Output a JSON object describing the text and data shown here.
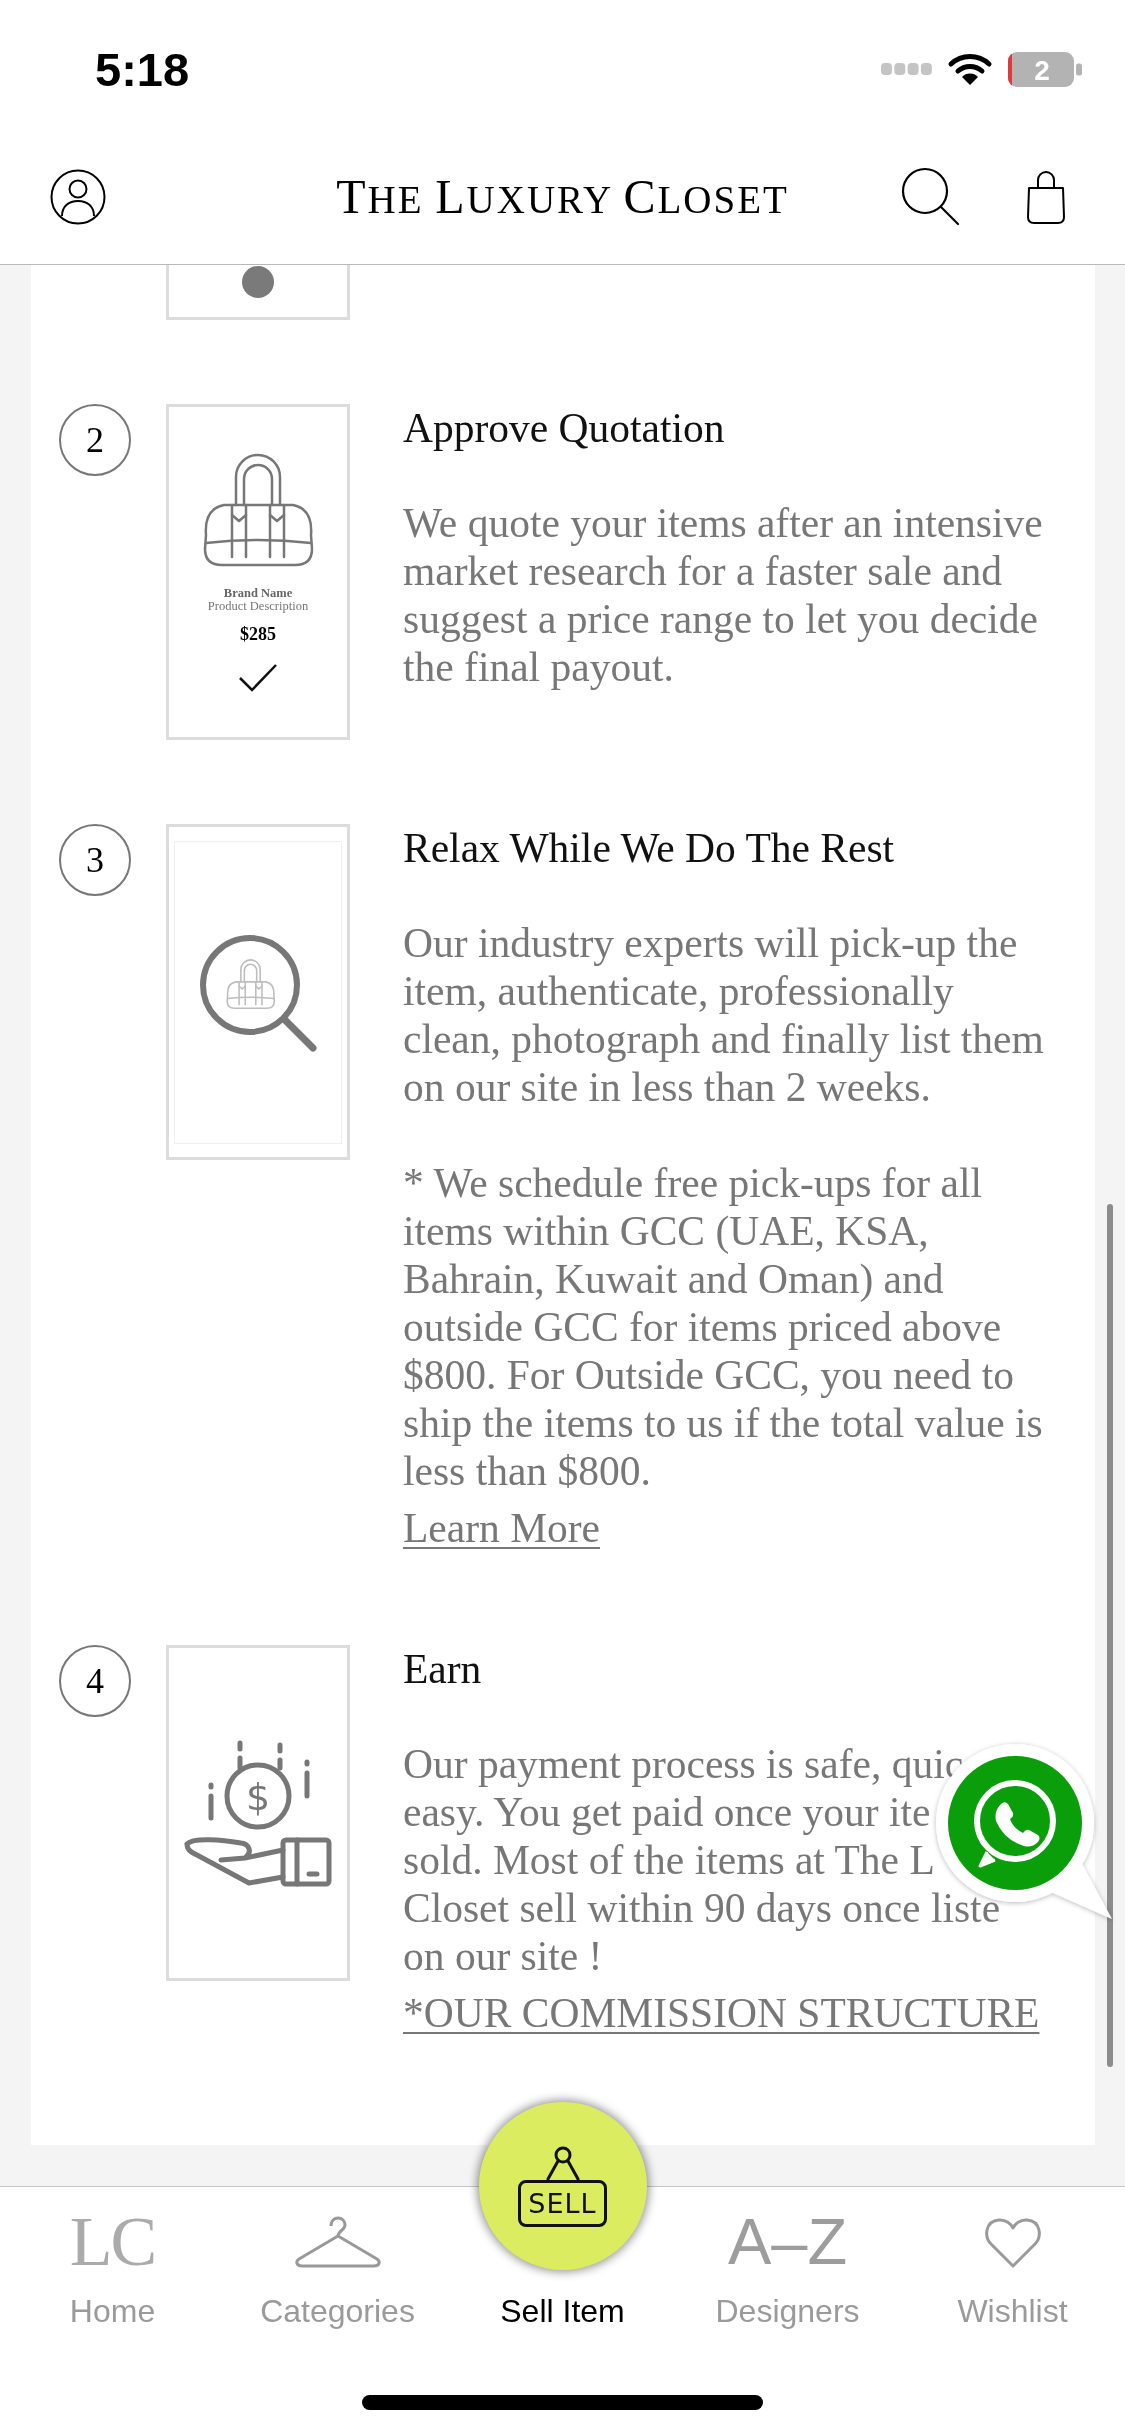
{
  "status_bar": {
    "time": "5:18",
    "battery": "2"
  },
  "header": {
    "title": "THE LUXURY CLOSET"
  },
  "steps": [
    {
      "kind": "cut",
      "illustration": {
        "kind": "dot"
      }
    },
    {
      "kind": "full",
      "number": "2",
      "title": "Approve Quotation",
      "paragraphs": [
        "We quote your items after an intensive market research for a faster sale and suggest a price range to let you decide the final payout."
      ],
      "illustration": {
        "kind": "product_card",
        "brand": "Brand Name",
        "description": "Product Description",
        "price": "$285"
      }
    },
    {
      "kind": "full",
      "number": "3",
      "title": "Relax While We Do The Rest",
      "paragraphs": [
        "Our industry experts will pick-up the item, authenticate, professionally clean, photograph and finally list them on our site in less than 2 weeks.",
        "* We schedule free pick-ups for all items within GCC (UAE, KSA, Bahrain, Kuwait and Oman) and outside GCC for items priced above $800. For Outside GCC, you need to ship the items to us if the total value is less than $800."
      ],
      "link": "Learn More",
      "illustration": {
        "kind": "magnifier"
      }
    },
    {
      "kind": "full",
      "number": "4",
      "title": "Earn",
      "visible_lines": [
        "Our payment process is safe, quic",
        "easy. You get paid once your ite",
        "sold. Most of the items at The L",
        "Closet sell within 90 days once liste",
        "on our site !"
      ],
      "link": "*OUR COMMISSION STRUCTURE",
      "illustration": {
        "kind": "coin_hand",
        "symbol": "$"
      }
    }
  ],
  "nav": {
    "items": [
      {
        "kind": "logo",
        "glyph": "LC",
        "label": "Home",
        "selected": false
      },
      {
        "kind": "hanger",
        "label": "Categories",
        "selected": false
      },
      {
        "kind": "sell",
        "glyph": "SELL",
        "label": "Sell Item",
        "selected": true
      },
      {
        "kind": "letters",
        "glyph": "A–Z",
        "label": "Designers",
        "selected": false
      },
      {
        "kind": "heart",
        "label": "Wishlist",
        "selected": false
      }
    ]
  }
}
